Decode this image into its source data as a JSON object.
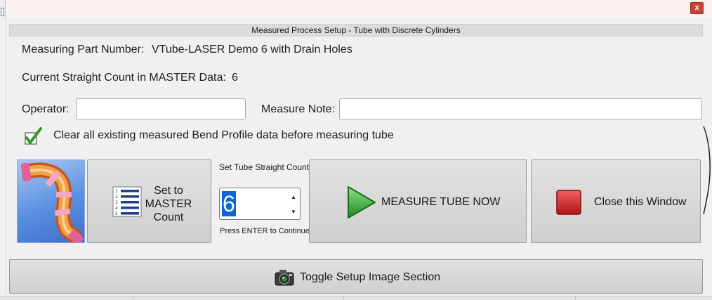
{
  "window": {
    "close_label": "x",
    "title": "Measured Process Setup - Tube with Discrete Cylinders"
  },
  "info": {
    "part_number_label": "Measuring Part Number:",
    "part_number_value": "VTube-LASER Demo 6 with Drain Holes",
    "straight_count_label": "Current Straight Count in MASTER Data:",
    "straight_count_value": "6"
  },
  "fields": {
    "operator_label": "Operator:",
    "operator_value": "",
    "measure_note_label": "Measure Note:",
    "measure_note_value": ""
  },
  "clear_option": {
    "checked": true,
    "label": "Clear all existing measured Bend Profile data before measuring tube"
  },
  "actions": {
    "set_master_label": "Set to MASTER Count",
    "spinner_label": "Set Tube Straight Count",
    "spinner_value": "6",
    "enter_hint": "Press ENTER to Continue",
    "measure_label": "MEASURE TUBE NOW",
    "close_label": "Close this Window",
    "toggle_label": "Toggle Setup Image Section"
  },
  "colors": {
    "measure_icon": "#3aa53a",
    "close_icon": "#d42a2a",
    "spinner_highlight": "#0a67d8"
  }
}
